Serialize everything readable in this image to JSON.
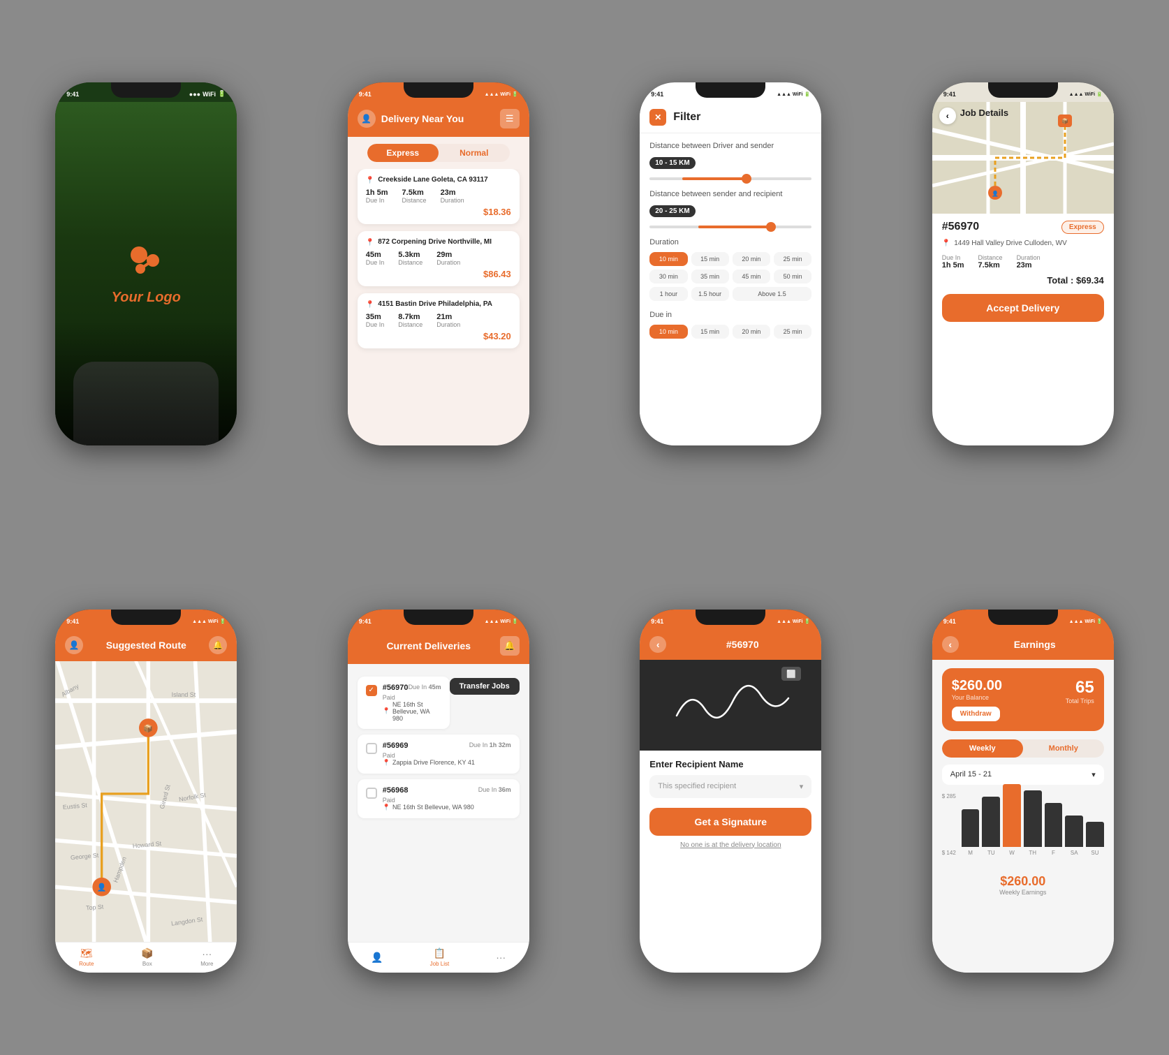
{
  "app": {
    "brand": "Your Logo",
    "status_time": "9:41"
  },
  "phone1": {
    "logo_text": "Your Logo",
    "screen_type": "splash"
  },
  "phone2": {
    "header_title": "Delivery Near You",
    "tab_express": "Express",
    "tab_normal": "Normal",
    "deliveries": [
      {
        "address": "Creekside Lane Goleta, CA 93117",
        "due_label": "Due In",
        "due_value": "1h 5m",
        "distance_label": "Distance",
        "distance_value": "7.5km",
        "duration_label": "Duration",
        "duration_value": "23m",
        "price": "$18.36"
      },
      {
        "address": "872 Corpening Drive Northville, MI",
        "due_label": "Due In",
        "due_value": "45m",
        "distance_label": "Distance",
        "distance_value": "5.3km",
        "duration_label": "Duration",
        "duration_value": "29m",
        "price": "$86.43"
      },
      {
        "address": "4151 Bastin Drive Philadelphia, PA",
        "due_label": "Due In",
        "due_value": "35m",
        "distance_label": "Distance",
        "distance_value": "8.7km",
        "duration_label": "Duration",
        "duration_value": "21m",
        "price": "$43.20"
      }
    ]
  },
  "phone3": {
    "header_title": "Filter",
    "section1_label": "Distance between Driver and sender",
    "section1_range": "10 - 15 KM",
    "section2_label": "Distance between sender and recipient",
    "section2_range": "20 - 25 KM",
    "duration_label": "Duration",
    "duration_chips": [
      "10 min",
      "15 min",
      "20 min",
      "25 min",
      "30 min",
      "35 min",
      "45 min",
      "50 min",
      "1 hour",
      "1.5 hour",
      "Above 1.5"
    ],
    "due_in_label": "Due in",
    "due_in_chips": [
      "10 min",
      "15 min",
      "20 min",
      "25 min"
    ]
  },
  "phone4": {
    "back_label": "Job Details",
    "job_id": "#56970",
    "job_badge": "Express",
    "job_address": "1449 Hall Valley Drive Culloden, WV",
    "due_label": "Due In",
    "due_value": "1h 5m",
    "distance_label": "Distance",
    "distance_value": "7.5km",
    "duration_label": "Duration",
    "duration_value": "23m",
    "total_label": "Total :",
    "total_value": "$69.34",
    "accept_btn": "Accept Delivery"
  },
  "phone5": {
    "header_title": "Suggested Route",
    "nav_route": "Route",
    "nav_items": [
      "Route",
      "Box",
      "More"
    ]
  },
  "phone6": {
    "header_title": "Current Deliveries",
    "transfer_btn": "Transfer Jobs",
    "deliveries": [
      {
        "id": "#56970",
        "status": "Paid",
        "due_label": "Due In",
        "due_value": "45m",
        "location": "NE 16th St Bellevue, WA 980",
        "checked": true
      },
      {
        "id": "#56969",
        "status": "Paid",
        "due_label": "Due In",
        "due_value": "1h 32m",
        "location": "Zappia Drive Florence, KY 41",
        "checked": false
      },
      {
        "id": "#56968",
        "status": "Paid",
        "due_label": "Due In",
        "due_value": "36m",
        "location": "NE 16th St Bellevue, WA 980",
        "checked": false
      }
    ],
    "nav_items": [
      "Profile",
      "Job List",
      "More"
    ]
  },
  "phone7": {
    "job_id": "#56970",
    "recipient_label": "Enter Recipient Name",
    "recipient_placeholder": "This specified recipient",
    "get_sig_btn": "Get a Signature",
    "no_one_text": "No one is at the delivery location"
  },
  "phone8": {
    "header_title": "Earnings",
    "balance_amount": "$260.00",
    "balance_label": "Your Balance",
    "withdraw_btn": "Withdraw",
    "trips_count": "65",
    "trips_label": "Total Trips",
    "tab_weekly": "Weekly",
    "tab_monthly": "Monthly",
    "date_range": "April 15 - 21",
    "chart_y_high": "$ 285",
    "chart_y_low": "$ 142",
    "chart_days": [
      "M",
      "TU",
      "W",
      "TH",
      "F",
      "SA",
      "SU"
    ],
    "chart_heights_pct": [
      60,
      80,
      100,
      90,
      70,
      50,
      40
    ],
    "weekly_earnings": "$260.00",
    "weekly_earnings_label": "Weekly Earnings"
  }
}
